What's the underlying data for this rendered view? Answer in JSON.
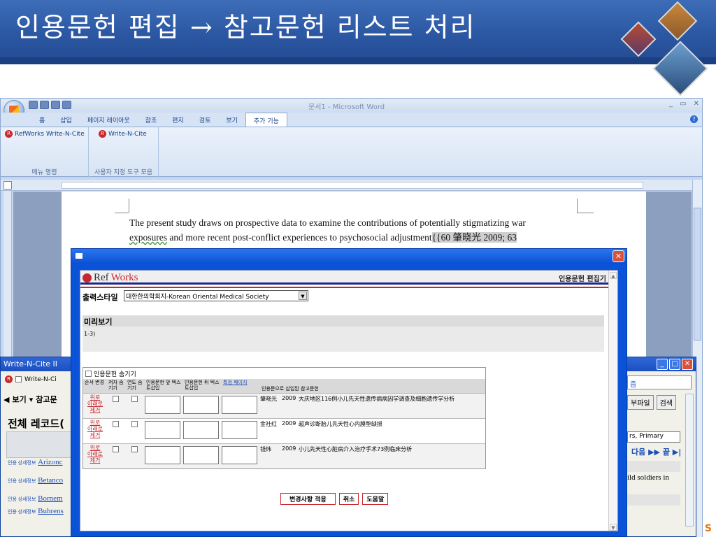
{
  "slide": {
    "title": "인용문헌 편집 → 참고문헌 리스트 처리",
    "corner_char": "S"
  },
  "word": {
    "window_title": "문서1 - Microsoft Word",
    "tabs": [
      "홈",
      "삽입",
      "페이지 레이아웃",
      "참조",
      "편지",
      "검토",
      "보기",
      "추가 기능"
    ],
    "active_tab": "추가 기능",
    "ribbon_groups": [
      {
        "button": "RefWorks Write-N-Cite",
        "label": "메뉴 명령"
      },
      {
        "button": "Write-N-Cite",
        "label": "사용자 지정 도구 모음"
      }
    ],
    "doc_line1": "The present study draws on prospective data to examine the contributions of potentially stigmatizing war",
    "doc_line2_a": "exposures",
    "doc_line2_b": "  and more recent post-conflict experiences to psychosocial adjustment",
    "doc_line2_cite": "{{60 肇晓光 2009; 63"
  },
  "wnc": {
    "title": "Write-N-Cite II",
    "toolbar_label": "Write-N-Ci",
    "view_label": "보기",
    "ref_label": "참고문",
    "heading": "전체 레코드(",
    "right_link": "즘",
    "attach_label": "부파일",
    "search_label": "검색",
    "select_value": "rs, Primary",
    "nav": "다음 ▶▶   끝 ▶|",
    "right_text": "ild soldiers in",
    "items": [
      {
        "small": "인용 상세정보",
        "title": "Arizonc"
      },
      {
        "small": "인용 상세정보",
        "title": "Betanco"
      },
      {
        "small": "인용 상세정보",
        "title": "Bornem"
      },
      {
        "small": "인용 상세정보",
        "title": "Buhrens"
      }
    ]
  },
  "dialog": {
    "logo_ref": "Ref",
    "logo_works": "Works",
    "header_right": "인용문헌 편집기",
    "output_label": "출력스타일",
    "output_value": "대한한의학회지-Korean Oriental Medical Society",
    "preview_label": "미리보기",
    "preview_text": "1-3)",
    "hide_label": "인용문헌 숨기기",
    "headers": [
      "순서 변경",
      "저자 숨기기",
      "연도 숨기기",
      "인용문헌 앞 텍스트삽입",
      "인용문헌 뒤 텍스트삽입",
      "특정 페이지",
      "인용문으로 삽입된 참고문헌"
    ],
    "order_links": [
      "위로",
      "아래로",
      "제거"
    ],
    "rows": [
      {
        "author": "肇晓光",
        "year": "2009",
        "title": "大庆地区116例小儿先天性遗传病病因学调查及细胞遗传学分析"
      },
      {
        "author": "金社红",
        "year": "2009",
        "title": "超声诊断胎儿先天性心内膜垫缺损"
      },
      {
        "author": "钱炜",
        "year": "2009",
        "title": "小儿先天性心脏病介入治疗手术73例临床分析"
      }
    ],
    "buttons": {
      "apply": "변경사항 적용",
      "cancel": "취소",
      "help": "도움말"
    }
  }
}
